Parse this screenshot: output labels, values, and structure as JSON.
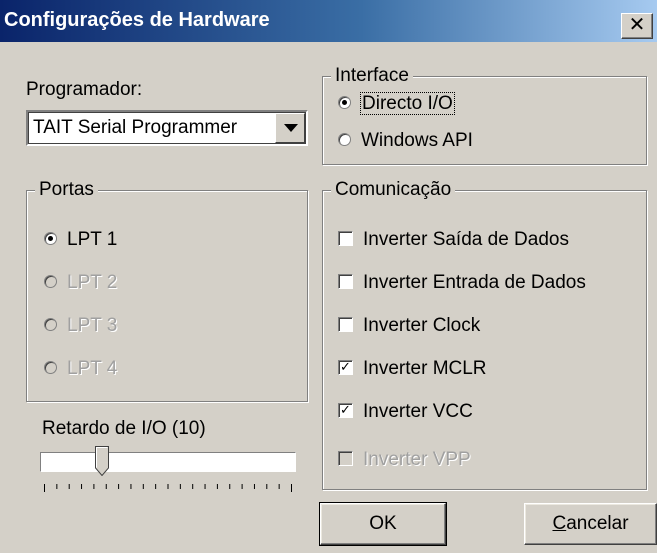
{
  "window": {
    "title": "Configurações de Hardware",
    "close_label": "x"
  },
  "programmer": {
    "label": "Programador:",
    "selected": "TAIT Serial Programmer"
  },
  "interface": {
    "legend": "Interface",
    "options": [
      {
        "label": "Directo I/O",
        "selected": true
      },
      {
        "label": "Windows API",
        "selected": false
      }
    ]
  },
  "ports": {
    "legend": "Portas",
    "options": [
      {
        "label": "LPT 1",
        "selected": true,
        "enabled": true
      },
      {
        "label": "LPT 2",
        "selected": false,
        "enabled": false
      },
      {
        "label": "LPT 3",
        "selected": false,
        "enabled": false
      },
      {
        "label": "LPT 4",
        "selected": false,
        "enabled": false
      }
    ]
  },
  "io_delay": {
    "label": "Retardo de I/O  (10)",
    "value": 10,
    "position_fraction": 0.27
  },
  "communication": {
    "legend": "Comunicação",
    "options": [
      {
        "label": "Inverter Saída de Dados",
        "checked": false,
        "enabled": true
      },
      {
        "label": "Inverter Entrada de Dados",
        "checked": false,
        "enabled": true
      },
      {
        "label": "Inverter Clock",
        "checked": false,
        "enabled": true
      },
      {
        "label": "Inverter MCLR",
        "checked": true,
        "enabled": true
      },
      {
        "label": "Inverter VCC",
        "checked": true,
        "enabled": true
      },
      {
        "label": "Inverter VPP",
        "checked": false,
        "enabled": false
      }
    ]
  },
  "buttons": {
    "ok": "OK",
    "cancel_first": "C",
    "cancel_rest": "ancelar"
  },
  "colors": {
    "titlebar": "#0a246a",
    "face": "#d4d0c8",
    "disabled_text": "#a0a0a0"
  }
}
